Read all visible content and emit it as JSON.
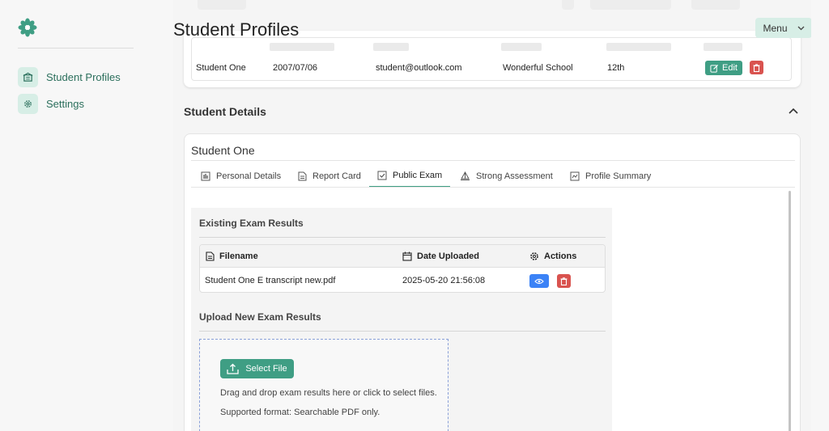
{
  "colors": {
    "brand": "#3f9e84",
    "brand_light": "#d7eee6",
    "danger": "#d9534f",
    "info": "#3b82f6"
  },
  "sidebar": {
    "logo_icon": "flower-logo-icon",
    "items": [
      {
        "label": "Student Profiles",
        "icon": "building-icon"
      },
      {
        "label": "Settings",
        "icon": "gear-icon"
      }
    ]
  },
  "header": {
    "title": "Student Profiles",
    "menu_label": "Menu"
  },
  "students_table": {
    "row": {
      "name": "Student One",
      "dob": "2007/07/06",
      "email": "student@outlook.com",
      "school": "Wonderful School",
      "grade": "12th",
      "edit_label": "Edit"
    }
  },
  "details": {
    "section_title": "Student Details",
    "student_name": "Student One",
    "tabs": [
      {
        "label": "Personal Details",
        "icon": "bar-chart-icon"
      },
      {
        "label": "Report Card",
        "icon": "document-icon"
      },
      {
        "label": "Public Exam",
        "icon": "checklist-icon",
        "active": true
      },
      {
        "label": "Strong Assessment",
        "icon": "sailboat-icon"
      },
      {
        "label": "Profile Summary",
        "icon": "chart-frame-icon"
      }
    ]
  },
  "exam": {
    "existing_title": "Existing Exam Results",
    "columns": {
      "filename": "Filename",
      "date": "Date Uploaded",
      "actions": "Actions"
    },
    "files": [
      {
        "filename": "Student One  E transcript new.pdf",
        "date": "2025-05-20 21:56:08"
      }
    ],
    "upload_title": "Upload New Exam Results",
    "select_label": "Select File",
    "drop_hint": "Drag and drop exam results here or click to select files.",
    "format_hint": "Supported format: Searchable PDF only."
  }
}
